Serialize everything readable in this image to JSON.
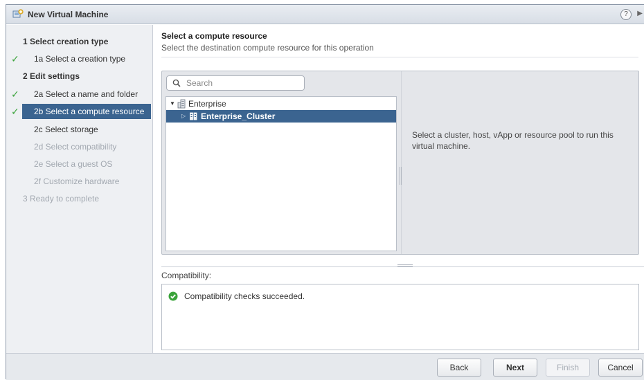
{
  "window": {
    "title": "New Virtual Machine",
    "help_label": "?",
    "expand_label": "▶"
  },
  "nav": {
    "items": [
      {
        "label": "1 Select creation type",
        "kind": "head",
        "check": false
      },
      {
        "label": "1a Select a creation type",
        "kind": "sub",
        "check": true
      },
      {
        "label": "2 Edit settings",
        "kind": "head",
        "check": false
      },
      {
        "label": "2a Select a name and folder",
        "kind": "sub",
        "check": true
      },
      {
        "label": "2b Select a compute resource",
        "kind": "sub",
        "check": true,
        "selected": true
      },
      {
        "label": "2c Select storage",
        "kind": "sub",
        "check": false
      },
      {
        "label": "2d Select compatibility",
        "kind": "sub",
        "check": false,
        "disabled": true
      },
      {
        "label": "2e Select a guest OS",
        "kind": "sub",
        "check": false,
        "disabled": true
      },
      {
        "label": "2f Customize hardware",
        "kind": "sub",
        "check": false,
        "disabled": true
      },
      {
        "label": "3 Ready to complete",
        "kind": "head",
        "check": false,
        "disabled": true
      }
    ],
    "check_glyph": "✓"
  },
  "page": {
    "title": "Select a compute resource",
    "description": "Select the destination compute resource for this operation"
  },
  "search": {
    "placeholder": "Search",
    "value": ""
  },
  "tree": {
    "nodes": [
      {
        "label": "Enterprise",
        "expanded": true,
        "type": "datacenter"
      },
      {
        "label": "Enterprise_Cluster",
        "expanded": false,
        "type": "cluster",
        "selected": true
      }
    ],
    "expanded_glyph": "▼",
    "collapsed_glyph": "▷"
  },
  "info": {
    "text": "Select a cluster, host, vApp or resource pool to run this virtual machine."
  },
  "compatibility": {
    "label": "Compatibility:",
    "message": "Compatibility checks succeeded.",
    "status_color": "#3aa33a"
  },
  "footer": {
    "back_label": "Back",
    "next_label": "Next",
    "finish_label": "Finish",
    "cancel_label": "Cancel"
  },
  "colors": {
    "selection": "#3b6490",
    "check": "#3aa33a"
  }
}
